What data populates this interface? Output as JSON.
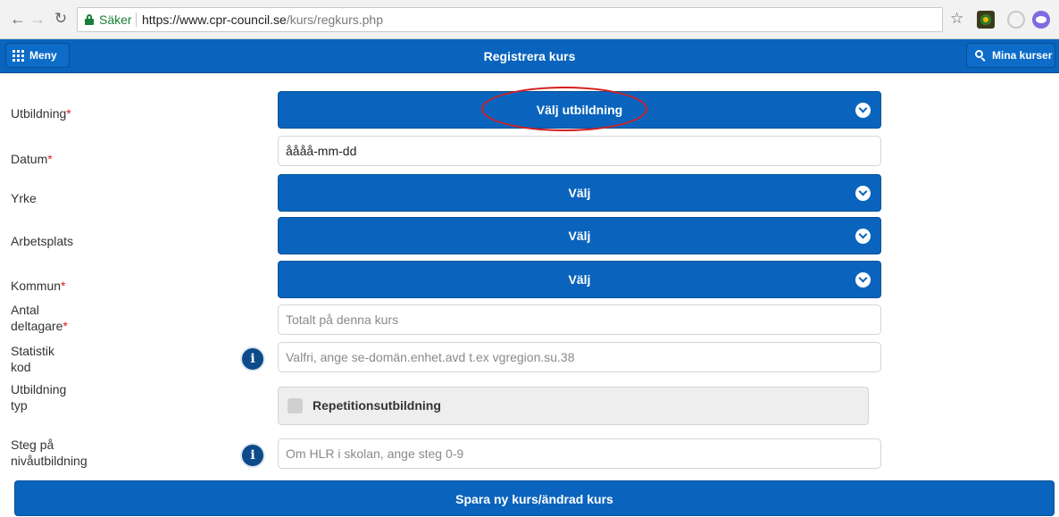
{
  "browser": {
    "secure_label": "Säker",
    "url_host": "https://www.cpr-council.se",
    "url_path": "/kurs/regkurs.php"
  },
  "header": {
    "menu_label": "Meny",
    "title": "Registrera kurs",
    "my_courses_label": "Mina kurser"
  },
  "form": {
    "utbildning": {
      "label": "Utbildning",
      "required": "*",
      "select_label": "Välj utbildning"
    },
    "datum": {
      "label": "Datum",
      "required": "*",
      "value": "åååå-mm-dd"
    },
    "yrke": {
      "label": "Yrke",
      "select_label": "Välj"
    },
    "arbetsplats": {
      "label": "Arbetsplats",
      "select_label": "Välj"
    },
    "kommun": {
      "label": "Kommun",
      "required": "*",
      "select_label": "Välj"
    },
    "antal": {
      "label_line1": "Antal",
      "label_line2": "deltagare",
      "required": "*",
      "placeholder": "Totalt på denna kurs"
    },
    "statistik": {
      "label_line1": "Statistik",
      "label_line2": "kod",
      "placeholder": "Valfri, ange se-domän.enhet.avd t.ex vgregion.su.38",
      "info_glyph": "i"
    },
    "utbildningstyp": {
      "label_line1": "Utbildning",
      "label_line2": "typ",
      "checkbox_label": "Repetitionsutbildning"
    },
    "steg": {
      "label_line1": "Steg på",
      "label_line2": "nivåutbildning",
      "placeholder": "Om HLR i skolan, ange steg 0-9",
      "info_glyph": "i"
    },
    "save_label": "Spara ny kurs/ändrad kurs"
  },
  "colors": {
    "primary": "#0a64bd",
    "required": "#d02020",
    "annotation": "#d61f1f"
  },
  "icons": [
    "back-arrow-icon",
    "forward-arrow-icon",
    "reload-icon",
    "lock-icon",
    "star-icon",
    "grid-icon",
    "search-icon",
    "chevron-down-icon",
    "info-icon"
  ]
}
